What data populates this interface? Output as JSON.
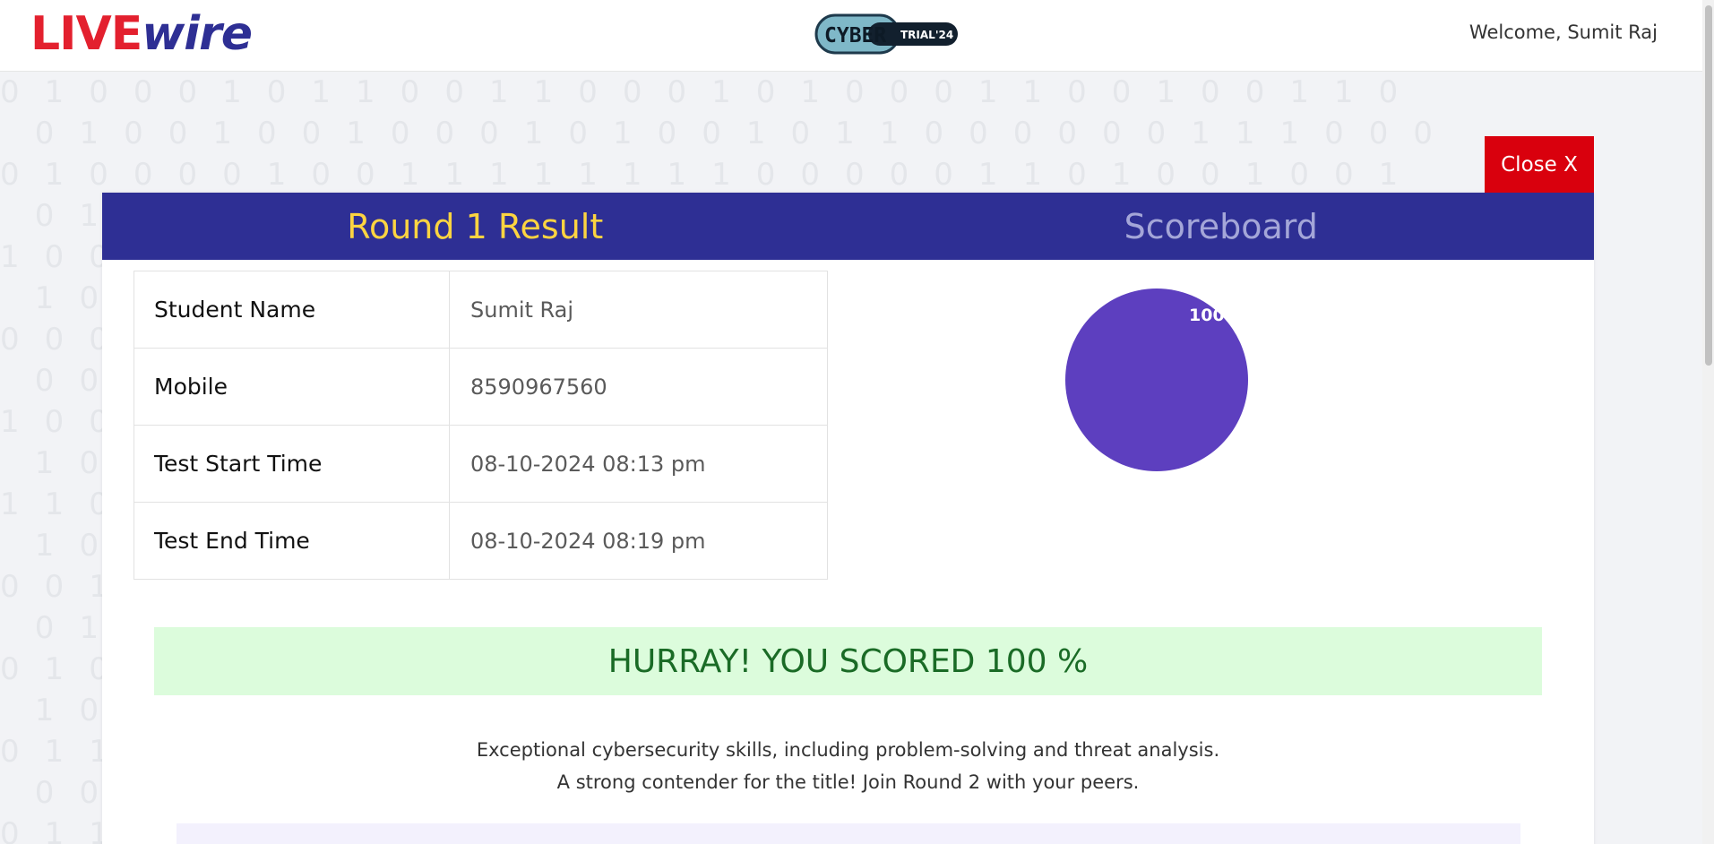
{
  "header": {
    "logo_live": "LIVE",
    "logo_wire": "wire",
    "badge_cyber": "CYBER",
    "badge_trial": "TRIAL'24",
    "welcome_text": "Welcome, Sumit Raj"
  },
  "close_label": "Close X",
  "tabs": [
    {
      "label": "Round 1 Result",
      "active": true
    },
    {
      "label": "Scoreboard",
      "active": false
    }
  ],
  "details": [
    {
      "label": "Student Name",
      "value": "Sumit Raj"
    },
    {
      "label": "Mobile",
      "value": "8590967560"
    },
    {
      "label": "Test Start Time",
      "value": "08-10-2024 08:13 pm"
    },
    {
      "label": "Test End Time",
      "value": "08-10-2024 08:19 pm"
    }
  ],
  "chart_data": {
    "type": "pie",
    "slices": [
      {
        "value": 100,
        "label": "100%",
        "color": "#5d3fbf"
      }
    ]
  },
  "banner_text": "HURRAY! YOU SCORED 100 %",
  "message_lines": [
    "Exceptional cybersecurity skills, including problem-solving and threat analysis.",
    "A strong contender for the title! Join Round 2 with your peers."
  ],
  "colors": {
    "brand_navy": "#2e2f94",
    "brand_red": "#e3202e",
    "accent_yellow": "#fcd441",
    "close_red": "#d9000d",
    "success_green": "#1a6b26"
  }
}
